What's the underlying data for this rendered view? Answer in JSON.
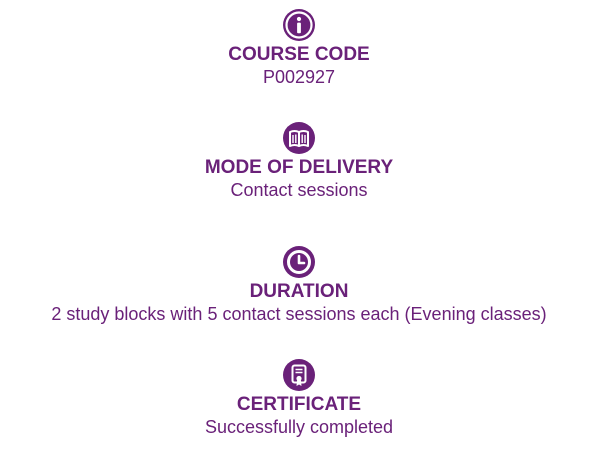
{
  "theme": {
    "accent": "#6a2179",
    "background": "#ffffff"
  },
  "items": [
    {
      "icon": "info-icon",
      "heading": "COURSE CODE",
      "value": "P002927"
    },
    {
      "icon": "book-icon",
      "heading": "MODE OF DELIVERY",
      "value": "Contact sessions"
    },
    {
      "icon": "clock-icon",
      "heading": "DURATION",
      "value": "2 study blocks with 5 contact sessions each (Evening classes)"
    },
    {
      "icon": "certificate-icon",
      "heading": "CERTIFICATE",
      "value": "Successfully completed"
    }
  ]
}
